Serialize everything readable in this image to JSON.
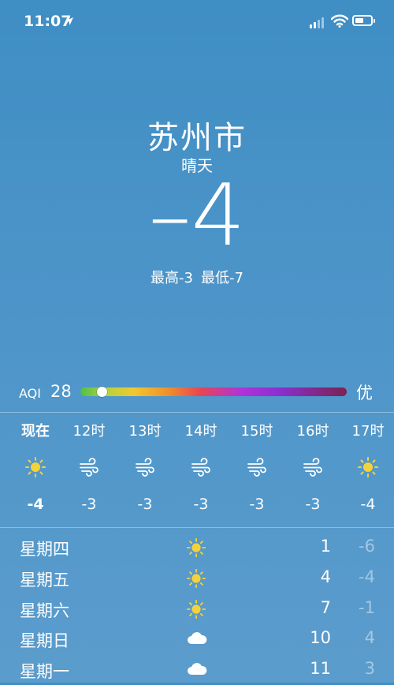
{
  "status_bar": {
    "time": "11:07"
  },
  "weather": {
    "city": "苏州市",
    "condition": "晴天",
    "temperature": "–4",
    "high": "最高-3",
    "low": "最低-7"
  },
  "aqi": {
    "label": "AQI",
    "value": "28",
    "level": "优",
    "position_fraction": 0.08
  },
  "hourly": [
    {
      "time": "现在",
      "icon": "sun-icon",
      "temp": "-4"
    },
    {
      "time": "12时",
      "icon": "wind-icon",
      "temp": "-3"
    },
    {
      "time": "13时",
      "icon": "wind-icon",
      "temp": "-3"
    },
    {
      "time": "14时",
      "icon": "wind-icon",
      "temp": "-3"
    },
    {
      "time": "15时",
      "icon": "wind-icon",
      "temp": "-3"
    },
    {
      "time": "16时",
      "icon": "wind-icon",
      "temp": "-3"
    },
    {
      "time": "17时",
      "icon": "sun-icon",
      "temp": "-4"
    }
  ],
  "daily": [
    {
      "day": "星期四",
      "icon": "sun-icon",
      "high": "1",
      "low": "-6"
    },
    {
      "day": "星期五",
      "icon": "sun-icon",
      "high": "4",
      "low": "-4"
    },
    {
      "day": "星期六",
      "icon": "sun-icon",
      "high": "7",
      "low": "-1"
    },
    {
      "day": "星期日",
      "icon": "cloud-icon",
      "high": "10",
      "low": "4"
    },
    {
      "day": "星期一",
      "icon": "cloud-icon",
      "high": "11",
      "low": "3"
    }
  ]
}
